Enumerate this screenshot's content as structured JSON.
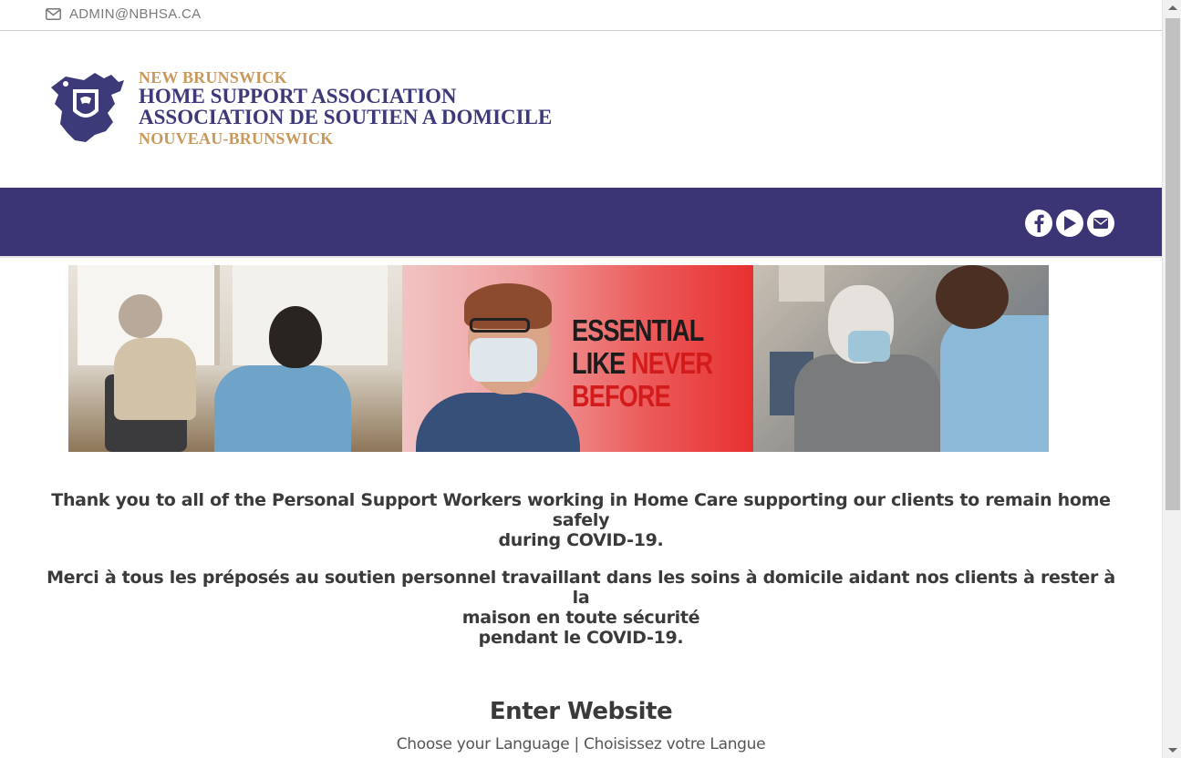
{
  "topbar": {
    "email": "ADMIN@NBHSA.CA",
    "email_icon": "envelope-icon"
  },
  "logo": {
    "line1": "NEW BRUNSWICK",
    "line2": "HOME SUPPORT ASSOCIATION",
    "line3": "ASSOCIATION DE SOUTIEN A DOMICILE",
    "line4": "NOUVEAU-BRUNSWICK",
    "colors": {
      "gold": "#c9985c",
      "purple": "#3d3a7a"
    }
  },
  "navbar": {
    "color": "#3b3575",
    "social": [
      {
        "name": "facebook-icon"
      },
      {
        "name": "youtube-play-icon"
      },
      {
        "name": "email-icon"
      }
    ]
  },
  "banner": {
    "slogan_line1": "ESSENTIAL",
    "slogan_line2_a": "LIKE ",
    "slogan_line2_b": "NEVER",
    "slogan_line3": "BEFORE"
  },
  "main": {
    "message_en_line1": "Thank you to all of the Personal Support Workers working in Home Care supporting our clients to remain home safely",
    "message_en_line2": "during COVID-19.",
    "message_fr_line1": "Merci à tous les préposés au soutien personnel travaillant dans les soins à domicile aidant nos clients à rester à la",
    "message_fr_line2": "maison en toute sécurité",
    "message_fr_line3": "pendant le COVID-19.",
    "enter_title": "Enter Website",
    "lang_en": "Choose your Language",
    "lang_sep": " | ",
    "lang_fr": "Choisissez votre Langue"
  }
}
